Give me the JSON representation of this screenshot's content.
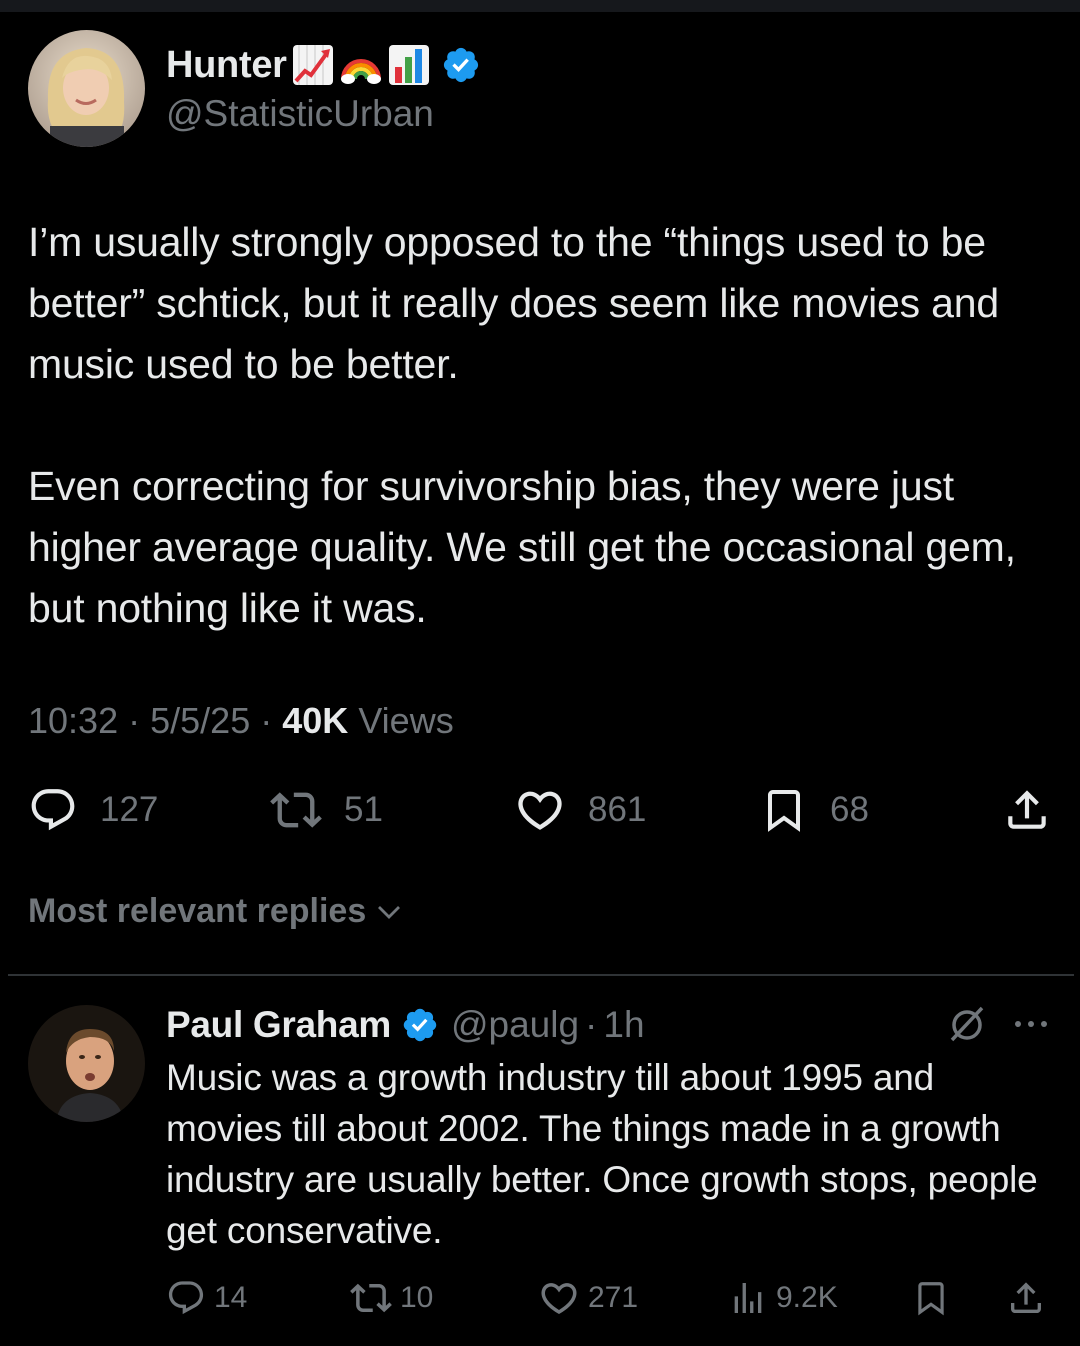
{
  "post": {
    "author": {
      "display_name": "Hunter",
      "emojis": [
        "chart-increasing-emoji",
        "rainbow-emoji",
        "bar-chart-emoji"
      ],
      "verified": true,
      "handle": "@StatisticUrban"
    },
    "paragraphs": [
      "I’m usually strongly opposed to the “things used to be better” schtick, but it really does seem like movies and music used to be better.",
      "Even correcting for survivorship bias, they were just higher average quality. We still get the occasional gem, but nothing like it was."
    ],
    "time": "10:32",
    "date": "5/5/25",
    "separator": "·",
    "views_count": "40K",
    "views_label": "Views",
    "stats": {
      "replies": "127",
      "reposts": "51",
      "likes": "861",
      "bookmarks": "68"
    }
  },
  "replies_section": {
    "sort_label": "Most relevant replies"
  },
  "reply": {
    "author": {
      "display_name": "Paul Graham",
      "verified": true,
      "handle": "@paulg"
    },
    "separator": "·",
    "time": "1h",
    "text": "Music was a growth industry till about 1995 and movies till about 2002. The things made in a growth industry are usually better. Once growth stops, people get conservative.",
    "stats": {
      "replies": "14",
      "reposts": "10",
      "likes": "271",
      "views": "9.2K"
    }
  },
  "colors": {
    "background": "#000000",
    "primary_text": "#e7e9ea",
    "secondary_text": "#71767b",
    "verified_blue": "#1d9bf0",
    "divider": "#2f3336"
  }
}
